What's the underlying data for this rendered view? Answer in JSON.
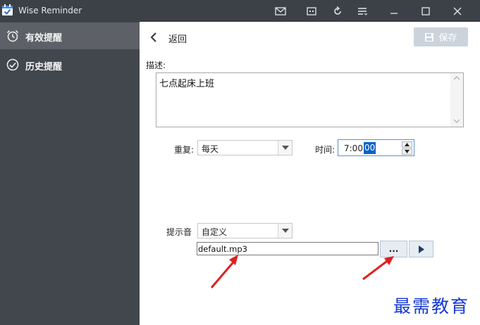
{
  "window": {
    "title": "Wise Reminder",
    "controls": [
      "mail-icon",
      "feedback-icon",
      "refresh-icon",
      "menu-icon",
      "minimize-icon",
      "maximize-icon",
      "close-icon"
    ]
  },
  "sidebar": {
    "items": [
      {
        "label": "有效提醒",
        "icon": "alarm-clock-icon",
        "active": true
      },
      {
        "label": "历史提醒",
        "icon": "check-circle-icon",
        "active": false
      }
    ]
  },
  "header": {
    "back_label": "返回",
    "save_label": "保存"
  },
  "form": {
    "description_label": "描述:",
    "description_value": "七点起床上班",
    "repeat_label": "重复:",
    "repeat_value": "每天",
    "time_label": "时间:",
    "time_prefix": "7:00:",
    "time_selected": "00",
    "sound_label": "提示音",
    "sound_value": "自定义",
    "file_value": "default.mp3",
    "browse_label": "..."
  },
  "watermark": "最需教育",
  "colors": {
    "titlebar": "#3c4148",
    "sidebar": "#42474d",
    "sidebar_active": "#5d6167",
    "accent": "#0a64c8",
    "save_button": "#cbd3dc",
    "annotation_arrow": "#e02020",
    "watermark": "#1638d4"
  }
}
